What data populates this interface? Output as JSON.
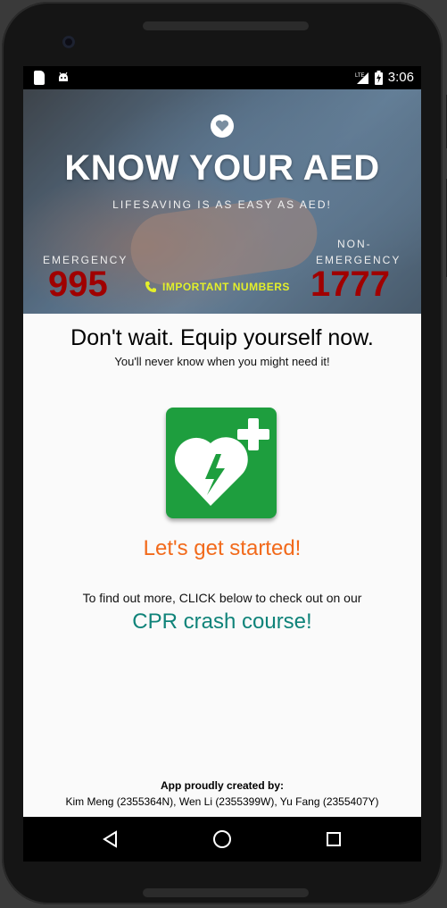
{
  "status_bar": {
    "time": "3:06",
    "network": "LTE"
  },
  "hero": {
    "title": "KNOW YOUR AED",
    "subtitle": "LIFESAVING IS AS EASY AS AED!",
    "emergency_label": "EMERGENCY",
    "emergency_number": "995",
    "non_emergency_label_line1": "NON-",
    "non_emergency_label_line2": "EMERGENCY",
    "non_emergency_number": "1777",
    "important_numbers": "IMPORTANT NUMBERS"
  },
  "main": {
    "headline": "Don't wait. Equip yourself now.",
    "tagline": "You'll never know when you might need it!",
    "get_started": "Let's get started!",
    "find_out": "To find out more, CLICK below to check out on our",
    "cpr_link": "CPR crash course!"
  },
  "footer": {
    "credit_title": "App proudly created by:",
    "credit_names": "Kim Meng (2355364N), Wen Li (2355399W), Yu Fang (2355407Y)"
  },
  "colors": {
    "aed_green": "#1e9e3e",
    "start_orange": "#f26a1b",
    "cpr_teal": "#0f8379",
    "number_red": "#a00000",
    "important_yellow": "#e4ef2a"
  },
  "icons": [
    "sd-card-icon",
    "android-icon",
    "signal-icon",
    "battery-icon",
    "heart-icon",
    "phone-icon",
    "aed-heart-icon",
    "back-icon",
    "home-icon",
    "recents-icon"
  ]
}
